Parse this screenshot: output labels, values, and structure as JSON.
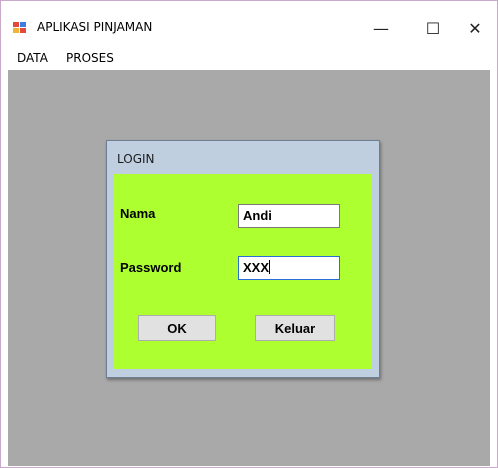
{
  "window": {
    "title": "APLIKASI PINJAMAN",
    "controls": {
      "minimize": "—",
      "maximize": "☐",
      "close": "✕"
    }
  },
  "menu": {
    "items": [
      "DATA",
      "PROSES"
    ]
  },
  "login_dialog": {
    "title": "LOGIN",
    "nama_label": "Nama",
    "nama_value": "Andi",
    "password_label": "Password",
    "password_value": "XXX",
    "ok_label": "OK",
    "keluar_label": "Keluar"
  },
  "colors": {
    "client_bg": "#a9a9a9",
    "dialog_body": "#adff2f",
    "dialog_frame": "#bfcfe0",
    "button_bg": "#e1e1e1"
  }
}
